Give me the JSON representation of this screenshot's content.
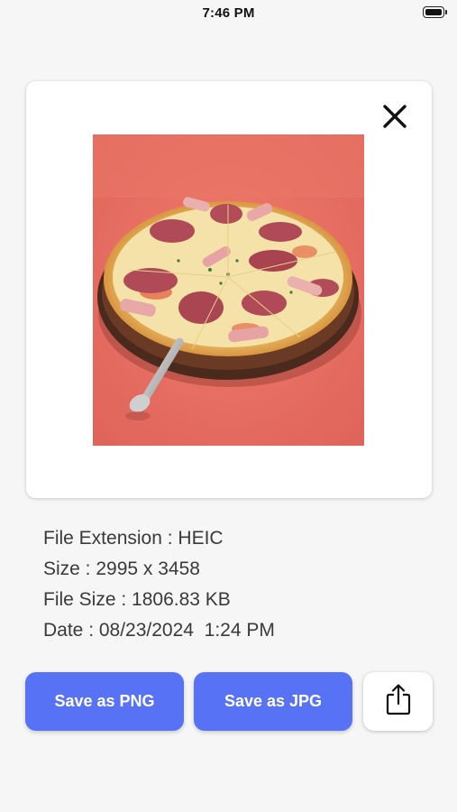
{
  "status_bar": {
    "time": "7:46 PM",
    "battery_icon": "battery-full-icon"
  },
  "image_card": {
    "close_icon": "close-icon",
    "photo_subject": "pizza photo"
  },
  "info": {
    "file_extension": "File Extension : HEIC",
    "size": "Size : 2995 x 3458",
    "file_size": "File Size : 1806.83 KB",
    "date": "Date : 08/23/2024  1:24 PM"
  },
  "actions": {
    "save_png_label": "Save as PNG",
    "save_jpg_label": "Save as JPG",
    "share_icon": "share-icon"
  },
  "colors": {
    "primary_button": "#5872f5",
    "background": "#f6f6f6",
    "card": "#ffffff"
  }
}
